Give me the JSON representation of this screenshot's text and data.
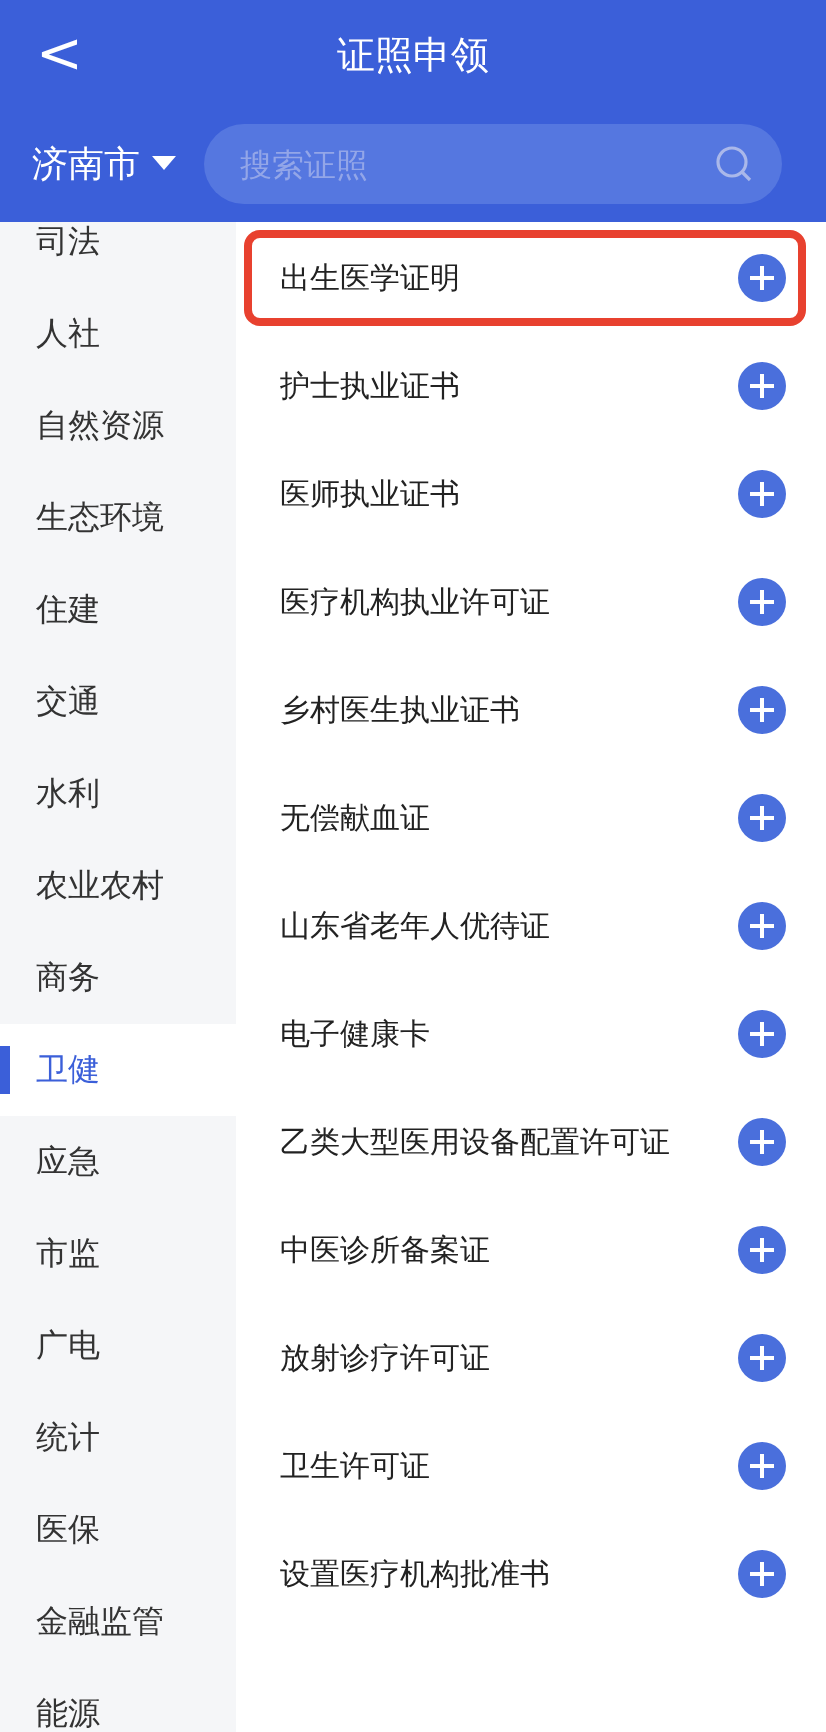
{
  "header": {
    "back_icon": "<",
    "title": "证照申领"
  },
  "city": {
    "label": "济南市"
  },
  "search": {
    "placeholder": "搜索证照"
  },
  "categories": [
    {
      "label": "司法",
      "selected": false
    },
    {
      "label": "人社",
      "selected": false
    },
    {
      "label": "自然资源",
      "selected": false
    },
    {
      "label": "生态环境",
      "selected": false
    },
    {
      "label": "住建",
      "selected": false
    },
    {
      "label": "交通",
      "selected": false
    },
    {
      "label": "水利",
      "selected": false
    },
    {
      "label": "农业农村",
      "selected": false
    },
    {
      "label": "商务",
      "selected": false
    },
    {
      "label": "卫健",
      "selected": true
    },
    {
      "label": "应急",
      "selected": false
    },
    {
      "label": "市监",
      "selected": false
    },
    {
      "label": "广电",
      "selected": false
    },
    {
      "label": "统计",
      "selected": false
    },
    {
      "label": "医保",
      "selected": false
    },
    {
      "label": "金融监管",
      "selected": false
    },
    {
      "label": "能源",
      "selected": false
    }
  ],
  "certificates": [
    {
      "label": "出生医学证明",
      "highlighted": true
    },
    {
      "label": "护士执业证书",
      "highlighted": false
    },
    {
      "label": "医师执业证书",
      "highlighted": false
    },
    {
      "label": "医疗机构执业许可证",
      "highlighted": false
    },
    {
      "label": "乡村医生执业证书",
      "highlighted": false
    },
    {
      "label": "无偿献血证",
      "highlighted": false
    },
    {
      "label": "山东省老年人优待证",
      "highlighted": false
    },
    {
      "label": "电子健康卡",
      "highlighted": false
    },
    {
      "label": "乙类大型医用设备配置许可证",
      "highlighted": false
    },
    {
      "label": "中医诊所备案证",
      "highlighted": false
    },
    {
      "label": "放射诊疗许可证",
      "highlighted": false
    },
    {
      "label": "卫生许可证",
      "highlighted": false
    },
    {
      "label": "设置医疗机构批准书",
      "highlighted": false
    }
  ]
}
